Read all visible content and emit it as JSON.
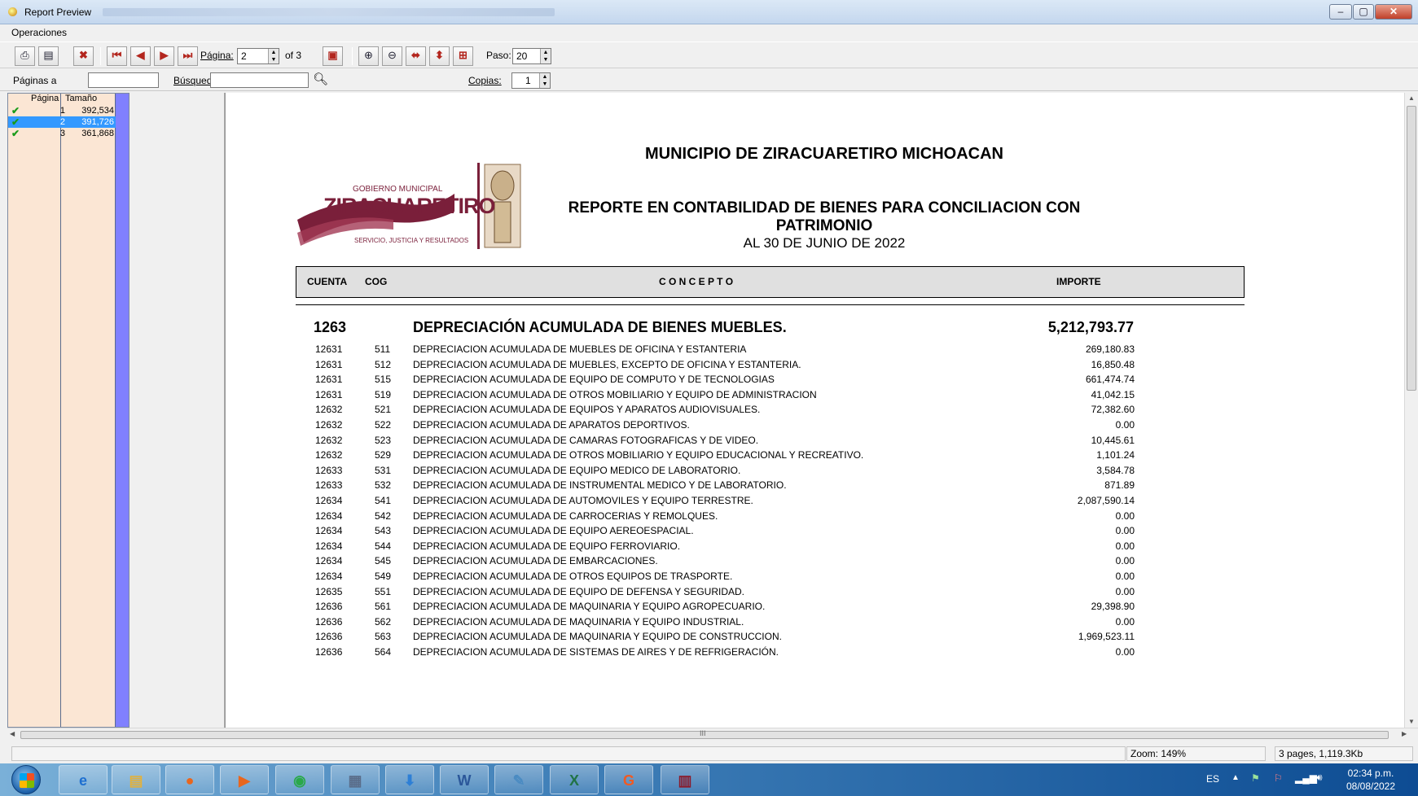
{
  "window": {
    "title": "Report Preview",
    "minimize": "–",
    "maximize": "▢",
    "close": "✕"
  },
  "menu": {
    "operaciones": "Operaciones"
  },
  "toolbar": {
    "pagina_label": "Página:",
    "pagina_value": "2",
    "of_label": "of 3",
    "paso_label": "Paso:",
    "paso_value": "20"
  },
  "toolbar2": {
    "paginas_label": "Páginas a",
    "busqueda_label": "Búsqued",
    "copias_label": "Copias:",
    "copias_value": "1"
  },
  "thumbs": {
    "col_pagina": "Página",
    "col_tamano": "Tamaño",
    "rows": [
      {
        "pagina": "1",
        "tamano": "392,534",
        "selected": false
      },
      {
        "pagina": "2",
        "tamano": "391,726",
        "selected": true
      },
      {
        "pagina": "3",
        "tamano": "361,868",
        "selected": false
      }
    ]
  },
  "report": {
    "title1": "MUNICIPIO DE ZIRACUARETIRO MICHOACAN",
    "title2": "REPORTE EN CONTABILIDAD DE BIENES PARA CONCILIACION CON PATRIMONIO",
    "title3": "AL 30 DE JUNIO DE 2022",
    "logo_top": "GOBIERNO MUNICIPAL",
    "logo_name": "ZIRACUARETIRO",
    "logo_motto": "SERVICIO, JUSTICIA Y RESULTADOS",
    "headers": {
      "cuenta": "CUENTA",
      "cog": "COG",
      "concepto": "C O N C E P T O",
      "importe": "IMPORTE"
    },
    "section": {
      "cuenta": "1263",
      "concepto": "DEPRECIACIÓN ACUMULADA DE BIENES MUEBLES.",
      "importe": "5,212,793.77"
    },
    "rows": [
      {
        "cuenta": "12631",
        "cog": "511",
        "concepto": "DEPRECIACION  ACUMULADA DE MUEBLES DE OFICINA Y ESTANTERIA",
        "importe": "269,180.83"
      },
      {
        "cuenta": "12631",
        "cog": "512",
        "concepto": "DEPRECIACION ACUMULADA DE MUEBLES, EXCEPTO DE OFICINA Y ESTANTERIA.",
        "importe": "16,850.48"
      },
      {
        "cuenta": "12631",
        "cog": "515",
        "concepto": "DEPRECIACION ACUMULADA DE EQUIPO DE COMPUTO Y DE TECNOLOGIAS",
        "importe": "661,474.74"
      },
      {
        "cuenta": "12631",
        "cog": "519",
        "concepto": "DEPRECIACION ACUMULADA DE OTROS MOBILIARIO Y EQUIPO DE ADMINISTRACION",
        "importe": "41,042.15"
      },
      {
        "cuenta": "12632",
        "cog": "521",
        "concepto": "DEPRECIACION ACUMULADA DE EQUIPOS Y APARATOS AUDIOVISUALES.",
        "importe": "72,382.60"
      },
      {
        "cuenta": "12632",
        "cog": "522",
        "concepto": "DEPRECIACION ACUMULADA DE APARATOS DEPORTIVOS.",
        "importe": "0.00"
      },
      {
        "cuenta": "12632",
        "cog": "523",
        "concepto": "DEPRECIACION ACUMULADA DE CAMARAS FOTOGRAFICAS Y DE VIDEO.",
        "importe": "10,445.61"
      },
      {
        "cuenta": "12632",
        "cog": "529",
        "concepto": "DEPRECIACION ACUMULADA DE OTROS MOBILIARIO Y EQUIPO EDUCACIONAL Y RECREATIVO.",
        "importe": "1,101.24"
      },
      {
        "cuenta": "12633",
        "cog": "531",
        "concepto": "DEPRECIACION ACUMULADA DE EQUIPO MEDICO DE LABORATORIO.",
        "importe": "3,584.78"
      },
      {
        "cuenta": "12633",
        "cog": "532",
        "concepto": "DEPRECIACION ACUMULADA DE INSTRUMENTAL MEDICO Y DE LABORATORIO.",
        "importe": "871.89"
      },
      {
        "cuenta": "12634",
        "cog": "541",
        "concepto": "DEPRECIACION ACUMULADA DE AUTOMOVILES Y EQUIPO TERRESTRE.",
        "importe": "2,087,590.14"
      },
      {
        "cuenta": "12634",
        "cog": "542",
        "concepto": "DEPRECIACION ACUMULADA DE CARROCERIAS Y REMOLQUES.",
        "importe": "0.00"
      },
      {
        "cuenta": "12634",
        "cog": "543",
        "concepto": "DEPRECIACION ACUMULADA DE EQUIPO AEREOESPACIAL.",
        "importe": "0.00"
      },
      {
        "cuenta": "12634",
        "cog": "544",
        "concepto": "DEPRECIACION ACUMULADA DE EQUIPO FERROVIARIO.",
        "importe": "0.00"
      },
      {
        "cuenta": "12634",
        "cog": "545",
        "concepto": "DEPRECIACION ACUMULADA DE EMBARCACIONES.",
        "importe": "0.00"
      },
      {
        "cuenta": "12634",
        "cog": "549",
        "concepto": "DEPRECIACION ACUMULADA DE OTROS EQUIPOS DE TRASPORTE.",
        "importe": "0.00"
      },
      {
        "cuenta": "12635",
        "cog": "551",
        "concepto": "DEPRECIACION ACUMULADA DE EQUIPO DE DEFENSA Y SEGURIDAD.",
        "importe": "0.00"
      },
      {
        "cuenta": "12636",
        "cog": "561",
        "concepto": "DEPRECIACION ACUMULADA DE MAQUINARIA Y EQUIPO AGROPECUARIO.",
        "importe": "29,398.90"
      },
      {
        "cuenta": "12636",
        "cog": "562",
        "concepto": "DEPRECIACION ACUMULADA DE MAQUINARIA Y EQUIPO INDUSTRIAL.",
        "importe": "0.00"
      },
      {
        "cuenta": "12636",
        "cog": "563",
        "concepto": "DEPRECIACION ACUMULADA DE MAQUINARIA Y EQUIPO DE CONSTRUCCION.",
        "importe": "1,969,523.11"
      },
      {
        "cuenta": "12636",
        "cog": "564",
        "concepto": "DEPRECIACION ACUMULADA DE SISTEMAS DE AIRES Y DE REFRIGERACIÓN.",
        "importe": "0.00"
      }
    ]
  },
  "status": {
    "zoom": "Zoom: 149%",
    "pages": "3 pages, 1,119.3Kb"
  },
  "taskbar": {
    "lang": "ES",
    "time": "02:34 p.m.",
    "date": "08/08/2022",
    "apps": [
      {
        "name": "ie",
        "glyph": "e",
        "color": "#1e6fd0"
      },
      {
        "name": "explorer",
        "glyph": "▤",
        "color": "#e2b13c"
      },
      {
        "name": "firefox",
        "glyph": "●",
        "color": "#e8661e"
      },
      {
        "name": "media",
        "glyph": "▶",
        "color": "#e8661e"
      },
      {
        "name": "chrome",
        "glyph": "◉",
        "color": "#2aa84a"
      },
      {
        "name": "calculator",
        "glyph": "▦",
        "color": "#5a6d8a"
      },
      {
        "name": "download",
        "glyph": "⬇",
        "color": "#2d7fd6"
      },
      {
        "name": "word",
        "glyph": "W",
        "color": "#2b579a"
      },
      {
        "name": "notes",
        "glyph": "✎",
        "color": "#4a8bc2"
      },
      {
        "name": "excel",
        "glyph": "X",
        "color": "#217346"
      },
      {
        "name": "pdf",
        "glyph": "G",
        "color": "#f15a22"
      },
      {
        "name": "winrar",
        "glyph": "▥",
        "color": "#8b1a2b"
      }
    ]
  }
}
